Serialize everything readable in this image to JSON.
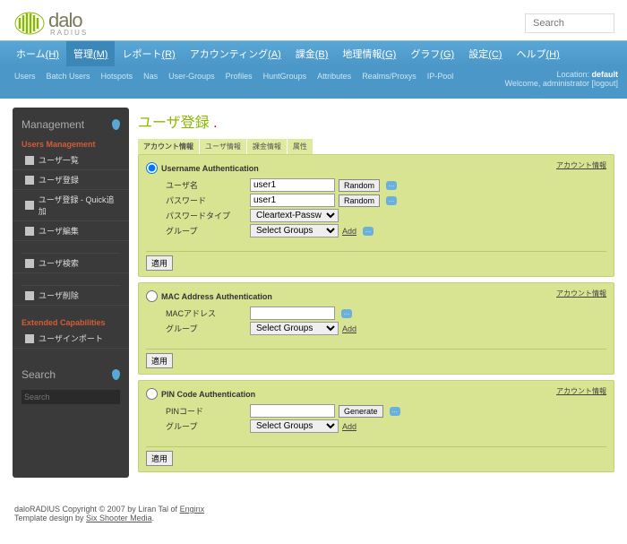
{
  "logo": {
    "main": "dalo",
    "sub": "RADIUS"
  },
  "search_placeholder": "Search",
  "main_nav": [
    {
      "label": "ホーム",
      "hot": "(H)"
    },
    {
      "label": "管理",
      "hot": "(M)",
      "active": true
    },
    {
      "label": "レポート",
      "hot": "(R)"
    },
    {
      "label": "アカウンティング",
      "hot": "(A)"
    },
    {
      "label": "課金",
      "hot": "(B)"
    },
    {
      "label": "地理情報",
      "hot": "(G)"
    },
    {
      "label": "グラフ",
      "hot": "(G)"
    },
    {
      "label": "設定",
      "hot": "(C)"
    },
    {
      "label": "ヘルプ",
      "hot": "(H)"
    }
  ],
  "sub_nav": [
    "Users",
    "Batch Users",
    "Hotspots",
    "Nas",
    "User-Groups",
    "Profiles",
    "HuntGroups",
    "Attributes",
    "Realms/Proxys",
    "IP-Pool"
  ],
  "location": {
    "prefix": "Location:",
    "value": "default",
    "welcome": "Welcome,",
    "user": "administrator",
    "logout": "[logout]"
  },
  "sidebar": {
    "management": "Management",
    "cat1": "Users Management",
    "items1": [
      "ユーザ一覧",
      "ユーザ登録",
      "ユーザ登録 - Quick追加",
      "ユーザ編集"
    ],
    "items1b": [
      "ユーザ検索"
    ],
    "items1c": [
      "ユーザ削除"
    ],
    "cat2": "Extended Capabilities",
    "items2": [
      "ユーザインポート"
    ],
    "search": "Search",
    "search_placeholder": "Search"
  },
  "page": {
    "title": "ユーザ登録"
  },
  "tabs": [
    "アカウント情報",
    "ユーザ情報",
    "課金情報",
    "属性"
  ],
  "acct_link": "アカウント情報",
  "panel1": {
    "title": "Username Authentication",
    "username_lbl": "ユーザ名",
    "username_val": "user1",
    "random": "Random",
    "password_lbl": "パスワード",
    "password_val": "user1",
    "ptype_lbl": "パスワードタイプ",
    "ptype_val": "Cleartext-Password",
    "group_lbl": "グループ",
    "group_val": "Select Groups",
    "add": "Add",
    "apply": "適用"
  },
  "panel2": {
    "title": "MAC Address Authentication",
    "mac_lbl": "MACアドレス",
    "group_lbl": "グループ",
    "group_val": "Select Groups",
    "add": "Add",
    "apply": "適用"
  },
  "panel3": {
    "title": "PIN Code Authentication",
    "pin_lbl": "PINコード",
    "generate": "Generate",
    "group_lbl": "グループ",
    "group_val": "Select Groups",
    "add": "Add",
    "apply": "適用"
  },
  "footer": {
    "l1a": "daloRADIUS Copyright © 2007 by Liran Tal of ",
    "l1b": "Enginx",
    "l2a": "Template design by ",
    "l2b": "Six Shooter Media",
    "l2c": "."
  }
}
